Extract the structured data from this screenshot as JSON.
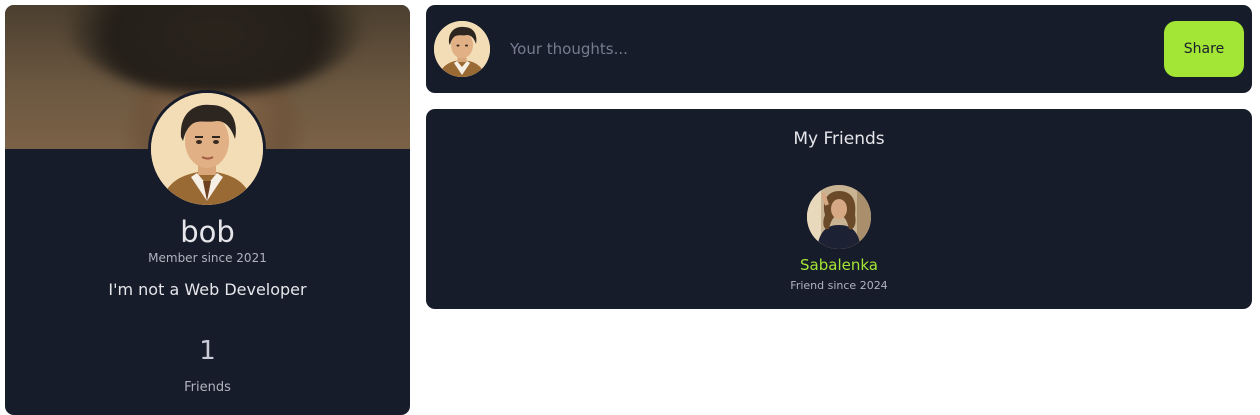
{
  "profile": {
    "name": "bob",
    "member_since": "Member since 2021",
    "bio": "I'm not a Web Developer",
    "friend_count": "1",
    "friend_count_label": "Friends"
  },
  "composer": {
    "placeholder": "Your thoughts...",
    "share_label": "Share"
  },
  "friends": {
    "title": "My Friends",
    "items": [
      {
        "name": "Sabalenka",
        "since": "Friend since 2024"
      }
    ]
  },
  "colors": {
    "card_bg": "#171c2b",
    "accent": "#a3e635",
    "text_primary": "#e6e6ea",
    "text_muted": "#b0b3bd"
  },
  "icons": {
    "profile_avatar": "man-portrait-avatar",
    "friend_avatar": "woman-portrait-avatar"
  }
}
